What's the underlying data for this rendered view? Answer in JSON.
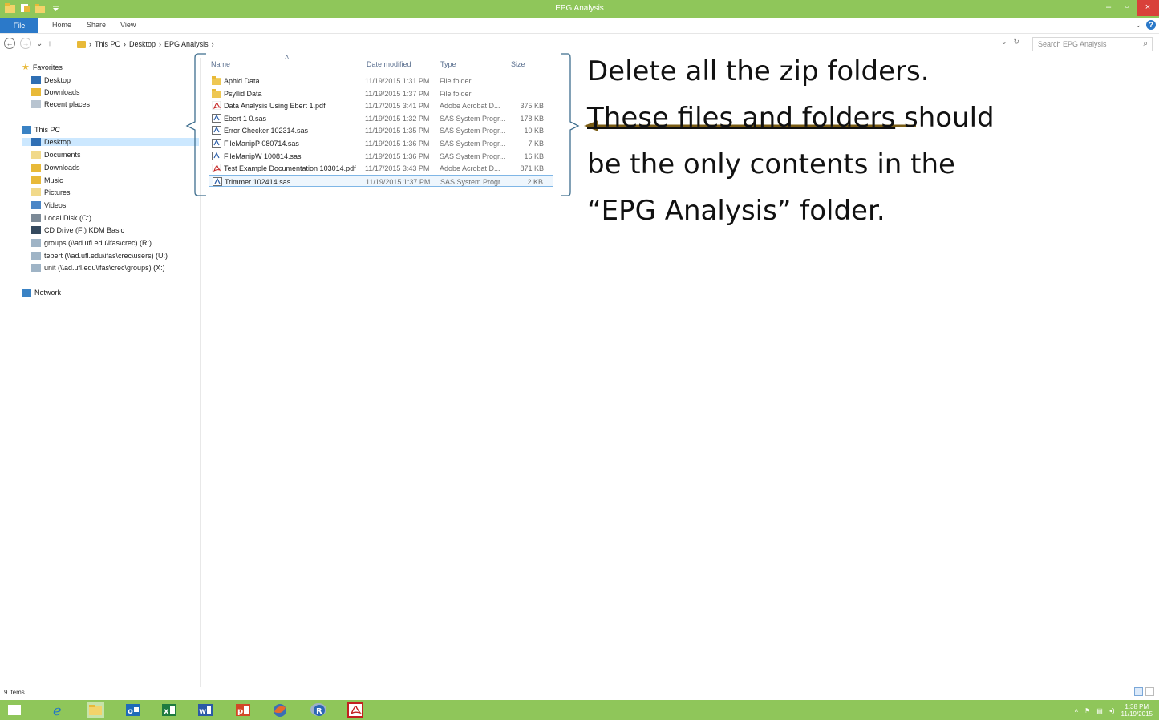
{
  "window": {
    "title": "EPG Analysis",
    "controls": {
      "minimize": "–",
      "maximize": "▫",
      "close": "×"
    }
  },
  "ribbon": {
    "tabs": [
      "File",
      "Home",
      "Share",
      "View"
    ],
    "expand_icon": "chevron-down-icon",
    "help_label": "?"
  },
  "address": {
    "breadcrumb": [
      "This PC",
      "Desktop",
      "EPG Analysis"
    ],
    "separator": "›",
    "search_placeholder": "Search EPG Analysis"
  },
  "nav_pane": {
    "favorites_header": "Favorites",
    "favorites": [
      "Desktop",
      "Downloads",
      "Recent places"
    ],
    "thispc_header": "This PC",
    "thispc": [
      "Desktop",
      "Documents",
      "Downloads",
      "Music",
      "Pictures",
      "Videos",
      "Local Disk (C:)",
      "CD Drive (F:) KDM Basic",
      "groups (\\\\ad.ufl.edu\\ifas\\crec) (R:)",
      "tebert (\\\\ad.ufl.edu\\ifas\\crec\\users) (U:)",
      "unit (\\\\ad.ufl.edu\\ifas\\crec\\groups) (X:)"
    ],
    "network_header": "Network",
    "selected": "Desktop"
  },
  "file_list": {
    "columns": {
      "name": "Name",
      "date": "Date modified",
      "type": "Type",
      "size": "Size"
    },
    "rows": [
      {
        "name": "Aphid Data",
        "date": "11/19/2015 1:31 PM",
        "type": "File folder",
        "size": "",
        "icon": "folder-icon"
      },
      {
        "name": "Psyllid Data",
        "date": "11/19/2015 1:37 PM",
        "type": "File folder",
        "size": "",
        "icon": "folder-icon"
      },
      {
        "name": "Data Analysis Using Ebert 1.pdf",
        "date": "11/17/2015 3:41 PM",
        "type": "Adobe Acrobat D...",
        "size": "375 KB",
        "icon": "pdf-icon"
      },
      {
        "name": "Ebert 1 0.sas",
        "date": "11/19/2015 1:32 PM",
        "type": "SAS System Progr...",
        "size": "178 KB",
        "icon": "sas-icon"
      },
      {
        "name": "Error Checker 102314.sas",
        "date": "11/19/2015 1:35 PM",
        "type": "SAS System Progr...",
        "size": "10 KB",
        "icon": "sas-icon"
      },
      {
        "name": "FileManipP 080714.sas",
        "date": "11/19/2015 1:36 PM",
        "type": "SAS System Progr...",
        "size": "7 KB",
        "icon": "sas-icon"
      },
      {
        "name": "FileManipW 100814.sas",
        "date": "11/19/2015 1:36 PM",
        "type": "SAS System Progr...",
        "size": "16 KB",
        "icon": "sas-icon"
      },
      {
        "name": "Test Example Documentation 103014.pdf",
        "date": "11/17/2015 3:43 PM",
        "type": "Adobe Acrobat D...",
        "size": "871 KB",
        "icon": "pdf-icon"
      },
      {
        "name": "Trimmer 102414.sas",
        "date": "11/19/2015 1:37 PM",
        "type": "SAS System Progr...",
        "size": "2 KB",
        "icon": "sas-icon"
      }
    ]
  },
  "annotation": {
    "line1": "Delete all the zip folders.",
    "line2_underlined": "These files and folders",
    "line2_rest": " should",
    "line3": "be the only contents in the",
    "line4": "“EPG Analysis” folder.",
    "arrow_color": "#7a5c14"
  },
  "status": {
    "count": "9 items"
  },
  "taskbar": {
    "apps": [
      "windows-start-icon",
      "internet-explorer-icon",
      "file-explorer-icon",
      "outlook-icon",
      "excel-icon",
      "word-icon",
      "powerpoint-icon",
      "firefox-icon",
      "r-icon",
      "acrobat-icon"
    ],
    "clock_time": "1:38 PM",
    "clock_date": "11/19/2015"
  },
  "colors": {
    "accent_green": "#8fc65a",
    "file_tab_blue": "#2b79c9",
    "close_red": "#d9413a"
  }
}
